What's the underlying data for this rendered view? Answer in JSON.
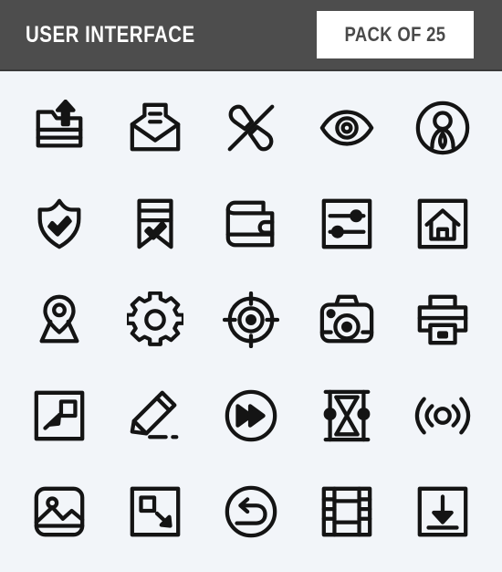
{
  "header": {
    "title": "USER INTERFACE",
    "badge_label": "PACK OF 25",
    "bar_color": "#4d4d4d",
    "badge_bg_color": "#ffffff",
    "title_color": "#ffffff",
    "badge_text_color": "#4a4a4a"
  },
  "page": {
    "background_color": "#f2f5f9",
    "icon_stroke_color": "#141414",
    "columns": 5,
    "rows": 5,
    "icon_count": 25
  },
  "icons": [
    {
      "name": "folder-upload-icon",
      "label": "Folder Upload"
    },
    {
      "name": "mail-open-document-icon",
      "label": "Open Mail"
    },
    {
      "name": "phone-off-icon",
      "label": "Call Disabled"
    },
    {
      "name": "eye-icon",
      "label": "View"
    },
    {
      "name": "user-circle-icon",
      "label": "User Profile"
    },
    {
      "name": "shield-check-icon",
      "label": "Security"
    },
    {
      "name": "bookmark-check-icon",
      "label": "Bookmark"
    },
    {
      "name": "wallet-icon",
      "label": "Wallet"
    },
    {
      "name": "settings-sliders-icon",
      "label": "Settings Sliders"
    },
    {
      "name": "home-square-icon",
      "label": "Home"
    },
    {
      "name": "map-pin-location-icon",
      "label": "Location"
    },
    {
      "name": "gear-icon",
      "label": "Settings"
    },
    {
      "name": "target-icon",
      "label": "Target"
    },
    {
      "name": "camera-icon",
      "label": "Camera"
    },
    {
      "name": "printer-icon",
      "label": "Printer"
    },
    {
      "name": "minimize-arrow-icon",
      "label": "Minimize"
    },
    {
      "name": "pencil-edit-icon",
      "label": "Edit"
    },
    {
      "name": "fast-forward-circle-icon",
      "label": "Fast Forward"
    },
    {
      "name": "hourglass-icon",
      "label": "Hourglass"
    },
    {
      "name": "wireless-signal-icon",
      "label": "Wireless Signal"
    },
    {
      "name": "image-photo-icon",
      "label": "Image"
    },
    {
      "name": "expand-arrow-icon",
      "label": "Expand"
    },
    {
      "name": "undo-circle-icon",
      "label": "Undo"
    },
    {
      "name": "film-strip-icon",
      "label": "Film"
    },
    {
      "name": "download-square-icon",
      "label": "Download"
    }
  ]
}
